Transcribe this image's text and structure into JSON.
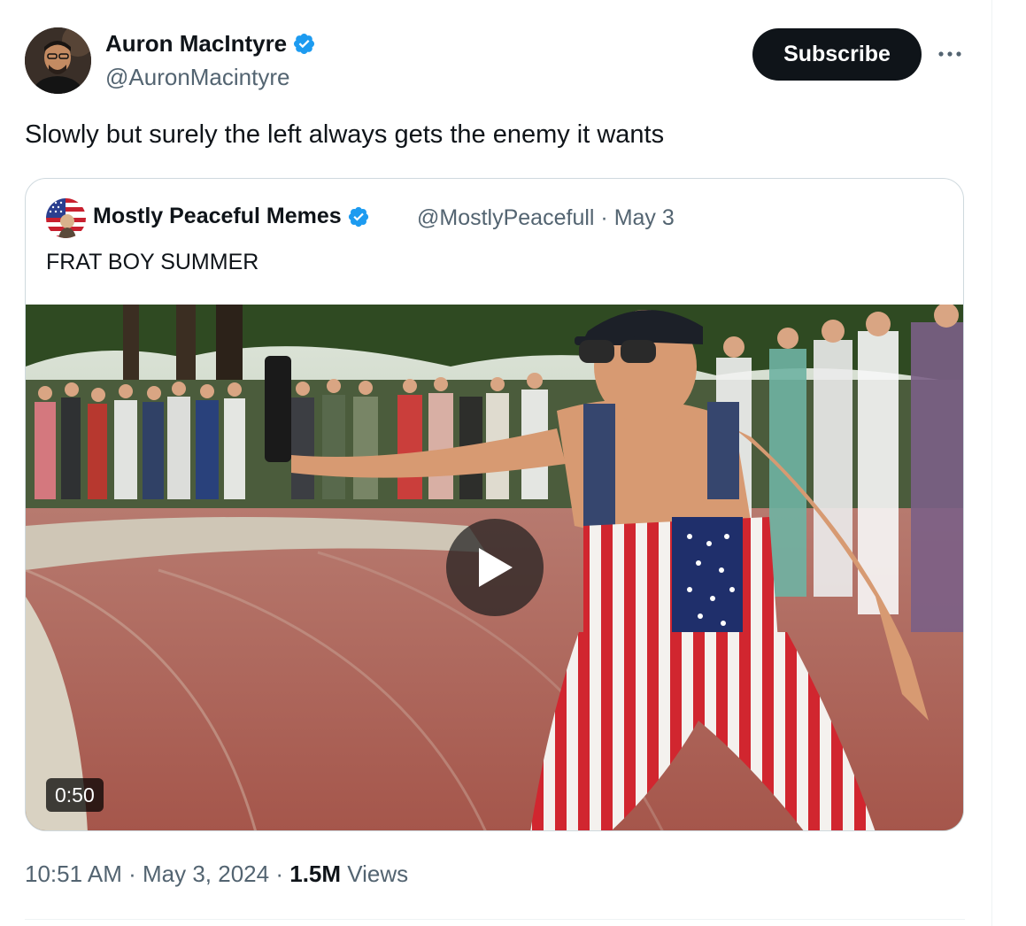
{
  "tweet": {
    "author": {
      "name": "Auron MacIntyre",
      "handle": "@AuronMacintyre",
      "verified_color": "#1d9bf0"
    },
    "subscribe_label": "Subscribe",
    "more_icon": "more-horizontal-icon",
    "text": "Slowly but surely the left always gets the enemy it wants",
    "quote": {
      "author_name": "Mostly Peaceful Memes",
      "handle": "@MostlyPeacefull",
      "separator": "·",
      "date": "May 3",
      "text": "FRAT BOY SUMMER",
      "video": {
        "duration": "0:50",
        "play_icon": "play-icon"
      }
    },
    "meta": {
      "time": "10:51 AM",
      "separator": "·",
      "date": "May 3, 2024",
      "views_count": "1.5M",
      "views_label": "Views"
    }
  },
  "colors": {
    "text_primary": "#0f1419",
    "text_secondary": "#536471",
    "verified": "#1d9bf0",
    "button_bg": "#0f1419",
    "border": "#cfd9de"
  }
}
